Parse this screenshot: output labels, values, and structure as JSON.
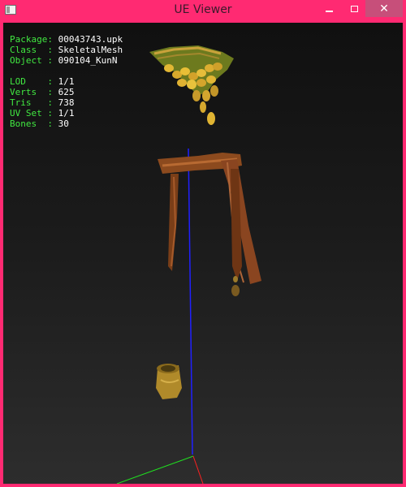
{
  "window": {
    "title": "UE Viewer",
    "controls": {
      "minimize": "minimize",
      "maximize": "maximize",
      "close": "✕"
    }
  },
  "info": {
    "package_label": "Package:",
    "package_value": "00043743.upk",
    "class_label": "Class  :",
    "class_value": "SkeletalMesh",
    "object_label": "Object :",
    "object_value": "090104_KunN",
    "lod_label": "LOD    :",
    "lod_value": "1/1",
    "verts_label": "Verts  :",
    "verts_value": "625",
    "tris_label": "Tris   :",
    "tris_value": "738",
    "uvset_label": "UV Set :",
    "uvset_value": "1/1",
    "bones_label": "Bones  :",
    "bones_value": "30"
  },
  "colors": {
    "frame": "#ff2a72",
    "label_green": "#41e841",
    "axis_x": "#ff2020",
    "axis_y": "#20e020",
    "axis_z": "#2020ff"
  },
  "icons": {
    "app": "app-icon",
    "minimize": "minimize-icon",
    "maximize": "maximize-icon",
    "close": "close-icon"
  }
}
